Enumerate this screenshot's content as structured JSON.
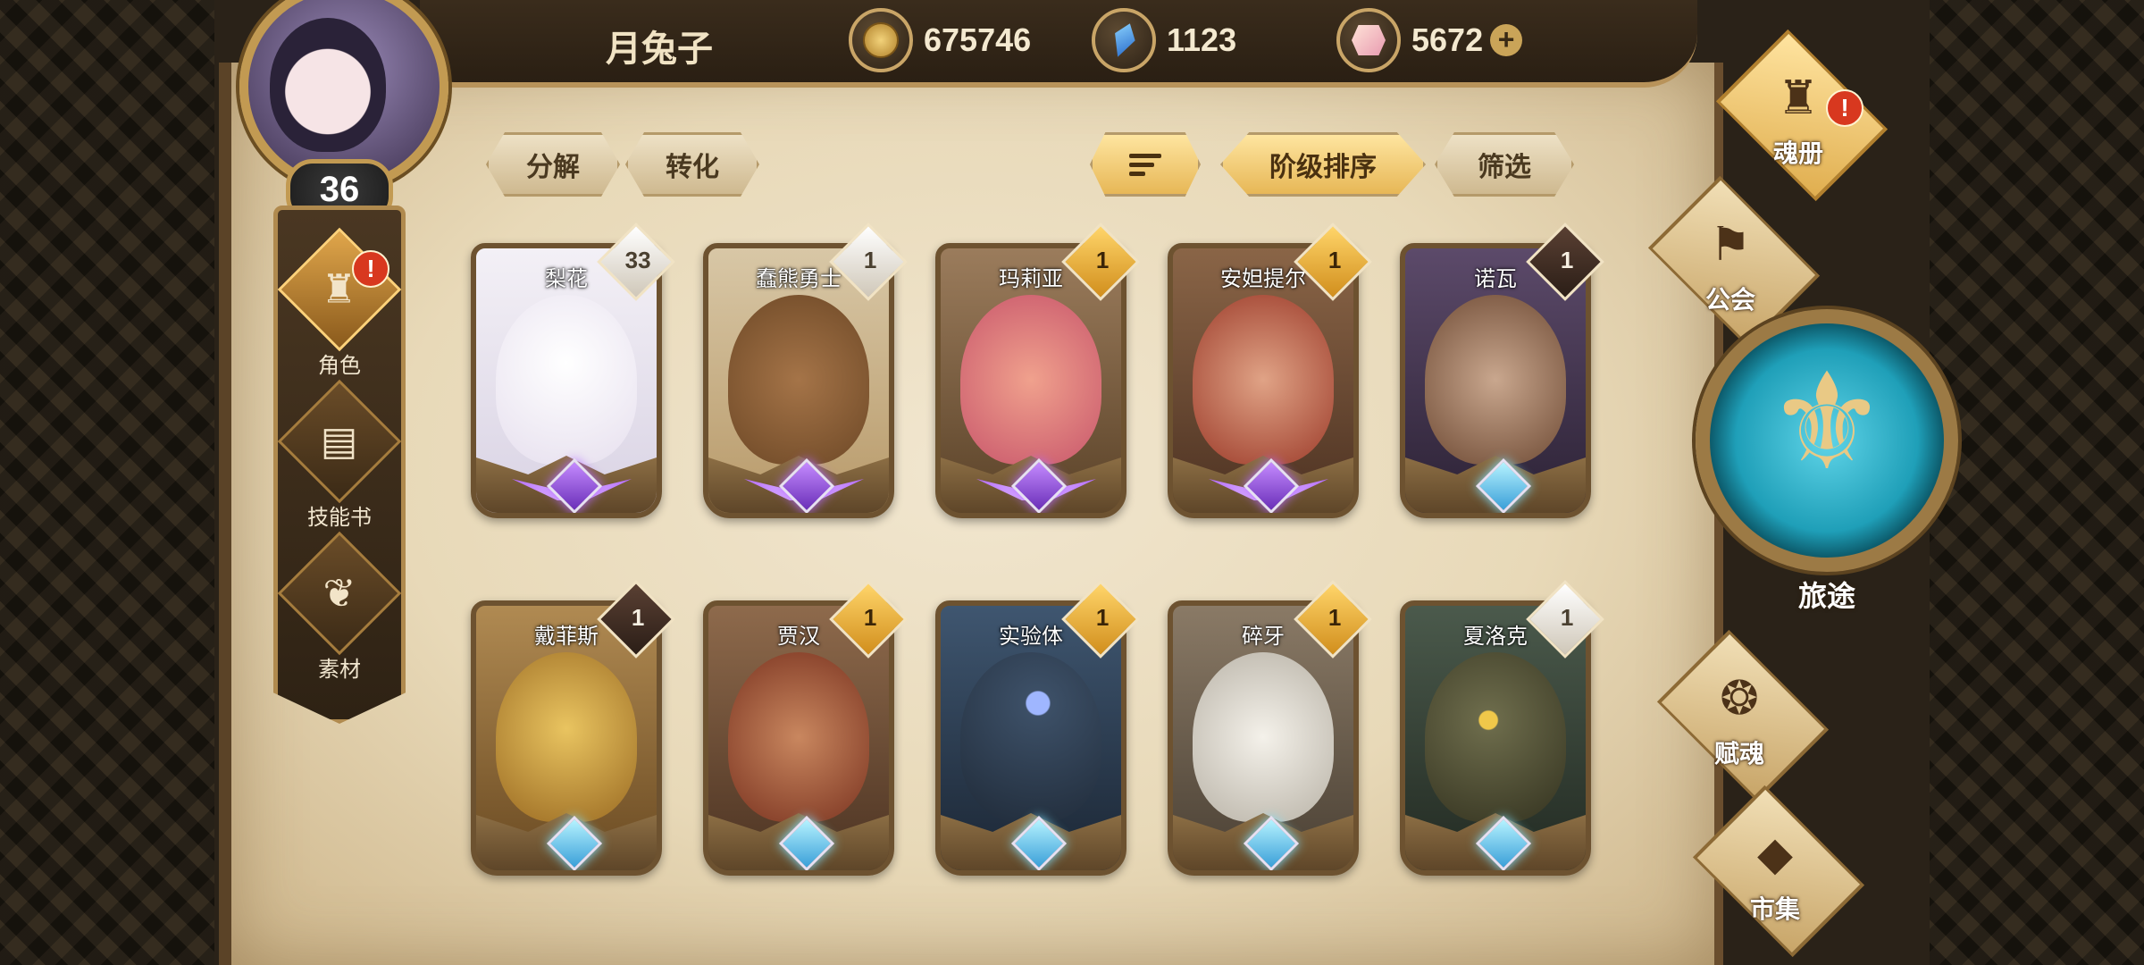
{
  "player": {
    "name": "月兔子",
    "level": "36"
  },
  "currencies": [
    {
      "icon": "gold-coin-icon",
      "value": "675746"
    },
    {
      "icon": "blue-crystal-icon",
      "value": "1123"
    },
    {
      "icon": "pink-gem-icon",
      "value": "5672"
    }
  ],
  "leftnav": {
    "items": [
      {
        "label": "角色",
        "icon": "character-helmet-icon",
        "active": true,
        "alert": "!"
      },
      {
        "label": "技能书",
        "icon": "skill-book-icon",
        "active": false
      },
      {
        "label": "素材",
        "icon": "material-icon",
        "active": false
      }
    ]
  },
  "toolbar": {
    "decompose": "分解",
    "convert": "转化",
    "sort_by_rank": "阶级排序",
    "filter": "筛选"
  },
  "cards": [
    {
      "name": "梨花",
      "count": "33",
      "badge": "white",
      "rank": "purple",
      "colors": [
        "#f3f0f6",
        "#d9d3e4"
      ]
    },
    {
      "name": "蠢熊勇士",
      "count": "1",
      "badge": "white",
      "rank": "purple",
      "colors": [
        "#a57448",
        "#6d4826"
      ]
    },
    {
      "name": "玛莉亚",
      "count": "1",
      "badge": "gold",
      "rank": "purple",
      "colors": [
        "#f0a18d",
        "#c8566b"
      ]
    },
    {
      "name": "安妲提尔",
      "count": "1",
      "badge": "gold",
      "rank": "purple",
      "colors": [
        "#e0a386",
        "#9c3b2a"
      ]
    },
    {
      "name": "诺瓦",
      "count": "1",
      "badge": "dark",
      "rank": "blue",
      "colors": [
        "#c9a78e",
        "#6e4a34"
      ]
    },
    {
      "name": "戴菲斯",
      "count": "1",
      "badge": "dark",
      "rank": "blue",
      "colors": [
        "#e9c460",
        "#9a6a22"
      ]
    },
    {
      "name": "贾汉",
      "count": "1",
      "badge": "gold",
      "rank": "blue",
      "colors": [
        "#c9875f",
        "#7a3320"
      ]
    },
    {
      "name": "实验体",
      "count": "1",
      "badge": "gold",
      "rank": "blue",
      "colors": [
        "#3c4f66",
        "#1f2a38"
      ]
    },
    {
      "name": "碎牙",
      "count": "1",
      "badge": "gold",
      "rank": "blue",
      "colors": [
        "#f4f1ea",
        "#b8b2a6"
      ]
    },
    {
      "name": "夏洛克",
      "count": "1",
      "badge": "white",
      "rank": "blue",
      "colors": [
        "#6b6a4a",
        "#33321f"
      ]
    }
  ],
  "rightnav": {
    "items": [
      {
        "label": "魂册",
        "icon": "soul-book-icon",
        "alert": "!",
        "active": true
      },
      {
        "label": "公会",
        "icon": "guild-icon",
        "active": false
      },
      {
        "label": "旅途",
        "icon": "journey-emblem-icon"
      },
      {
        "label": "赋魂",
        "icon": "soul-flame-icon",
        "active": false
      },
      {
        "label": "市集",
        "icon": "market-gem-icon",
        "active": false
      }
    ]
  }
}
